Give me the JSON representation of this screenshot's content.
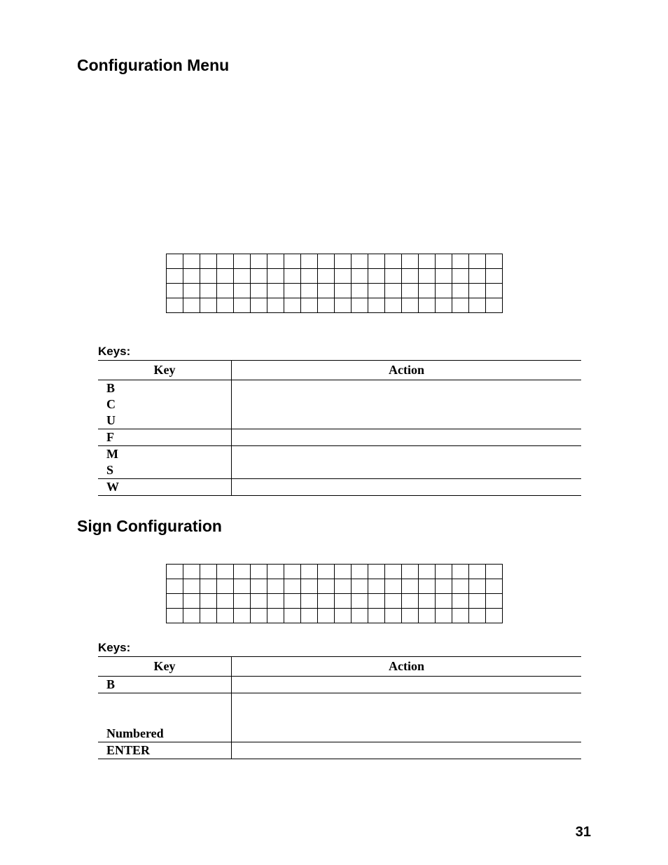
{
  "page_number": "31",
  "section1": {
    "title": "Configuration Menu",
    "keys_label": "Keys:",
    "headers": {
      "key": "Key",
      "action": "Action"
    },
    "rows": [
      {
        "key": "B",
        "action": ""
      },
      {
        "key": "C",
        "action": ""
      },
      {
        "key": "U",
        "action": ""
      },
      {
        "key": "F",
        "action": ""
      },
      {
        "key": "M",
        "action": ""
      },
      {
        "key": "S",
        "action": ""
      },
      {
        "key": "W",
        "action": ""
      }
    ]
  },
  "section2": {
    "title": "Sign Configuration",
    "keys_label": "Keys:",
    "headers": {
      "key": "Key",
      "action": "Action"
    },
    "rows": [
      {
        "key": "B",
        "action": ""
      },
      {
        "key": "",
        "action": ""
      },
      {
        "key": "Numbered",
        "action": ""
      },
      {
        "key": "ENTER",
        "action": ""
      }
    ]
  },
  "grid": {
    "rows": 4,
    "cols": 20
  }
}
